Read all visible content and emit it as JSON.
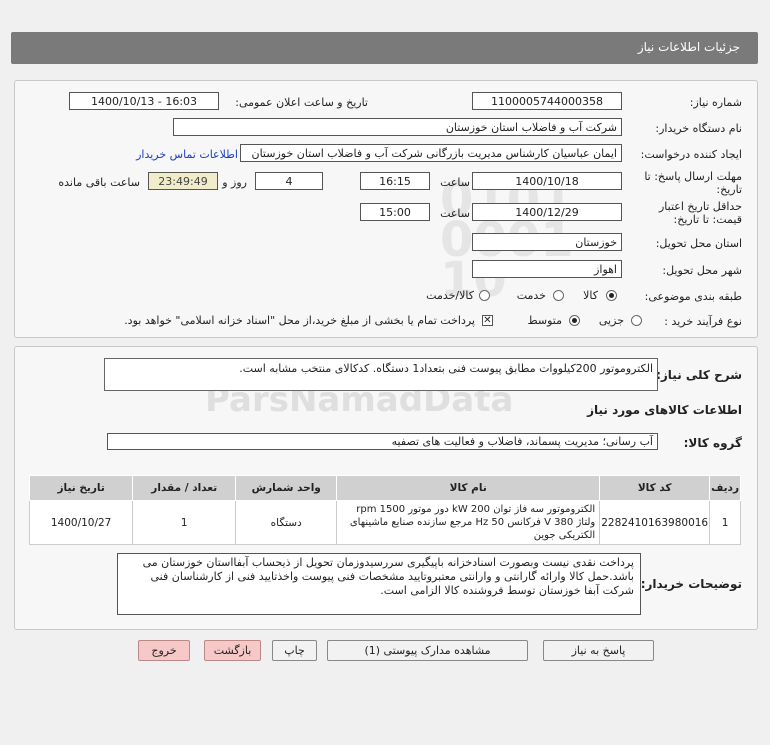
{
  "header": {
    "title": "جزئیات اطلاعات نیاز"
  },
  "fields": {
    "need_number_label": "شماره نیاز:",
    "need_number": "1100005744000358",
    "announce_label": "تاریخ و ساعت اعلان عمومی:",
    "announce_value": "1400/10/13 - 16:03",
    "buyer_label": "نام دستگاه خریدار:",
    "buyer_value": "شرکت آب و فاضلاب استان خوزستان",
    "creator_label": "ایجاد کننده درخواست:",
    "creator_value": "ایمان عباسیان کارشناس مدیریت بازرگانی شرکت آب و فاضلاب استان خوزستان",
    "contact_link": "اطلاعات تماس خریدار",
    "deadline_label": "مهلت ارسال پاسخ: تا تاریخ:",
    "deadline_date": "1400/10/18",
    "time_label": "ساعت",
    "deadline_time": "16:15",
    "days_value": "4",
    "days_label": "روز و",
    "remaining_time": "23:49:49",
    "remaining_label": "ساعت باقی مانده",
    "validity_label": "حداقل تاریخ اعتبار قیمت: تا تاریخ:",
    "validity_date": "1400/12/29",
    "validity_time_label": "ساعت",
    "validity_time": "15:00",
    "province_label": "استان محل تحویل:",
    "province_value": "خوزستان",
    "city_label": "شهر محل تحویل:",
    "city_value": "اهواز",
    "category_label": "طبقه بندی موضوعی:",
    "category_options": [
      "کالا",
      "خدمت",
      "کالا/خدمت"
    ],
    "process_label": "نوع فرآیند خرید :",
    "process_options": [
      "جزیی",
      "متوسط"
    ],
    "payment_note": "پرداخت تمام یا بخشی از مبلغ خرید،از محل \"اسناد خزانه اسلامی\" خواهد بود."
  },
  "summary": {
    "label": "شرح کلی نیاز:",
    "value": "الکتروموتور 200کیلووات مطابق پیوست فنی بتعداد1 دستگاه. کدکالای منتخب مشابه است."
  },
  "goods": {
    "section_title": "اطلاعات کالاهای مورد نیاز",
    "group_label": "گروه کالا:",
    "group_value": "آب رسانی؛ مدیریت پسماند، فاضلاب و فعالیت های تصفیه",
    "columns": [
      "ردیف",
      "کد کالا",
      "نام کالا",
      "واحد شمارش",
      "تعداد / مقدار",
      "تاریخ نیاز"
    ],
    "rows": [
      {
        "index": "1",
        "code": "2282410163980016",
        "name": "الکتروموتور سه فاز توان 200 kW دور موتور 1500 rpm ولتاژ 380 V فرکانس 50 Hz مرجع سازنده صنایع ماشینهای الکتریکی جوین",
        "unit": "دستگاه",
        "qty": "1",
        "date": "1400/10/27"
      }
    ]
  },
  "notes": {
    "label": "توضیحات خریدار:",
    "value": "پرداخت نقدی نیست وبصورت اسنادخزانه باپیگیری سررسیدوزمان تحویل از ذیحساب آبفااستان خوزستان می باشد.حمل کالا وارائه گارانتی و وارانتی معتبروتایید مشخصات فنی پیوست واخذتایید فنی از کارشناسان فنی شرکت آبفا خوزستان توسط فروشنده کالا الزامی است."
  },
  "buttons": {
    "reply": "پاسخ به نیاز",
    "attachments": "مشاهده مدارک پیوستی (1)",
    "print": "چاپ",
    "back": "بازگشت",
    "exit": "خروج"
  }
}
